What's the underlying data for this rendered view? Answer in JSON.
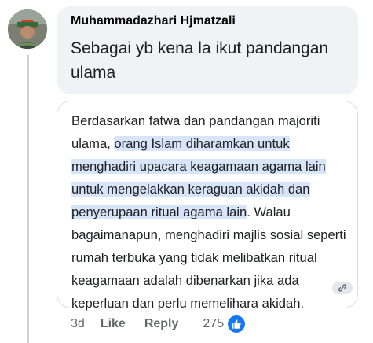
{
  "comment": {
    "author": "Muhammadazhari Hjmatzali",
    "text": "Sebagai yb kena la ikut pandangan ulama",
    "time": "3d",
    "like_label": "Like",
    "reply_label": "Reply",
    "reaction_count": "275"
  },
  "attachment": {
    "intro": "Berdasarkan fatwa dan pandangan majoriti ulama, ",
    "highlighted": "orang Islam diharamkan untuk menghadiri upacara keagamaan agama lain untuk mengelakkan keraguan akidah dan penyerupaan ritual agama lain",
    "rest": ". Walau bagaimanapun, menghadiri majlis sosial seperti rumah terbuka yang tidak melibatkan ritual keagamaan adalah dibenarkan jika ada keperluan dan perlu memelihara akidah.",
    "highlight_color": "#d8e4f8"
  },
  "icons": {
    "avatar": "profile-photo",
    "link": "link-icon",
    "reaction": "thumbs-up-icon"
  },
  "colors": {
    "bubble": "#f0f2f5",
    "meta_text": "#65676b",
    "like_blue": "#1877f2"
  }
}
